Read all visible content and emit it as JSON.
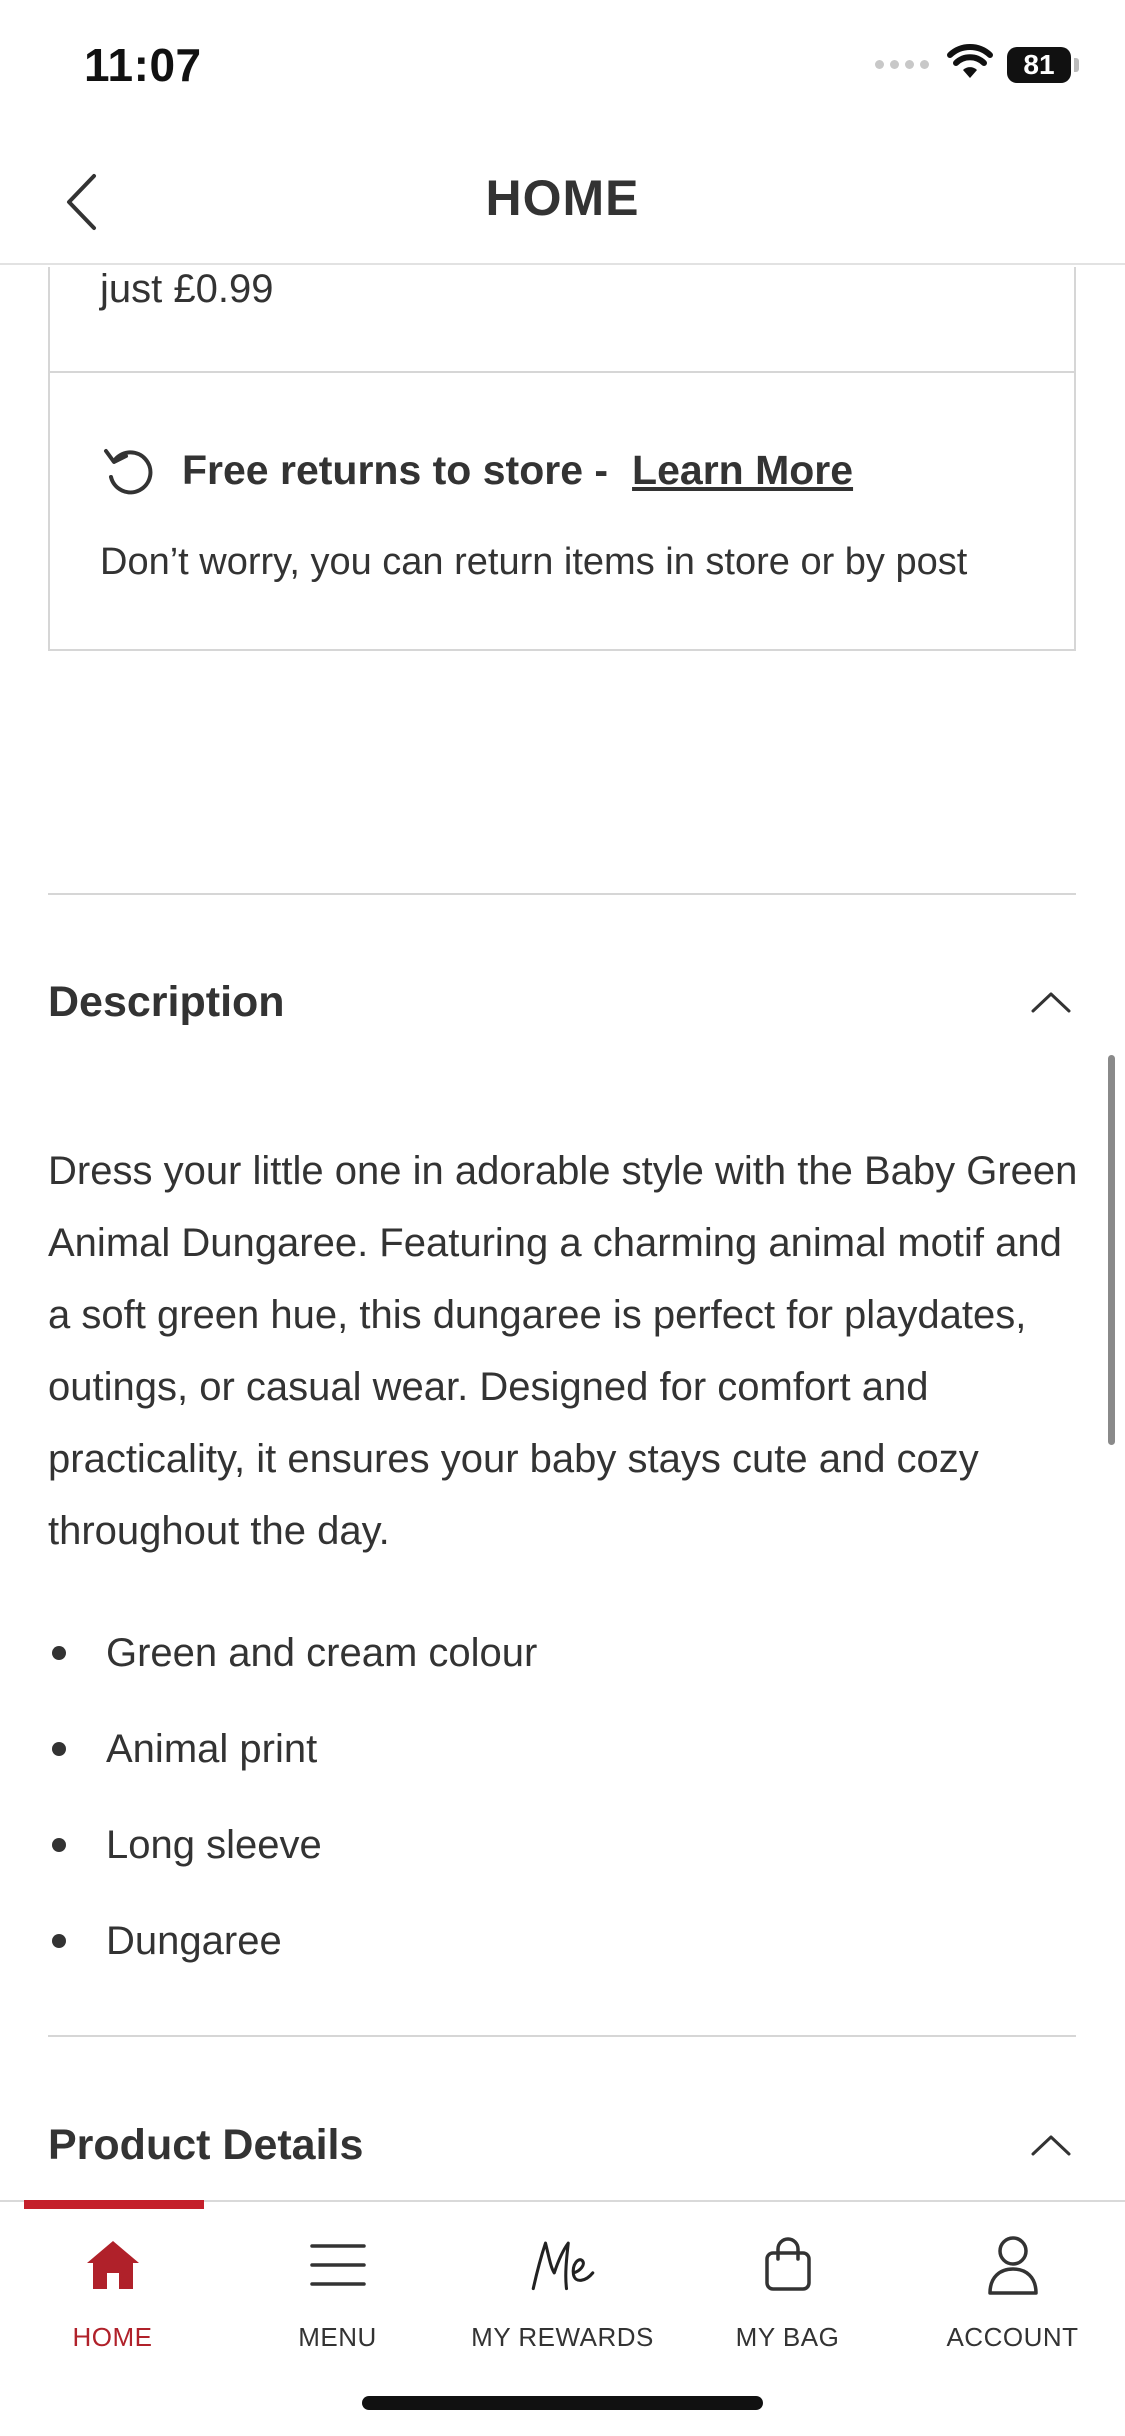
{
  "status_bar": {
    "time": "11:07",
    "battery": "81"
  },
  "header": {
    "title": "HOME"
  },
  "delivery_box": {
    "text": "just £0.99"
  },
  "returns_box": {
    "title": "Free returns to store -",
    "link": "Learn More",
    "subtitle": "Don’t worry, you can return items in store or by post"
  },
  "description": {
    "title": "Description",
    "body": "Dress your little one in adorable style with the Baby Green Animal Dungaree. Featuring a charming animal motif and a soft green hue, this dungaree is perfect for playdates, outings, or casual wear. Designed for comfort and practicality, it ensures your baby stays cute and cozy throughout the day.",
    "bullets": [
      "Green and cream colour",
      "Animal print",
      "Long sleeve",
      "Dungaree"
    ]
  },
  "product_details": {
    "title": "Product Details"
  },
  "bottom_nav": {
    "items": [
      {
        "label": "HOME",
        "icon": "home-icon",
        "active": true
      },
      {
        "label": "MENU",
        "icon": "menu-icon",
        "active": false
      },
      {
        "label": "MY REWARDS",
        "icon": "rewards-icon",
        "active": false
      },
      {
        "label": "MY BAG",
        "icon": "bag-icon",
        "active": false
      },
      {
        "label": "ACCOUNT",
        "icon": "account-icon",
        "active": false
      }
    ]
  },
  "colors": {
    "accent": "#c4202b",
    "text": "#333333",
    "border": "#d6d6d6"
  }
}
